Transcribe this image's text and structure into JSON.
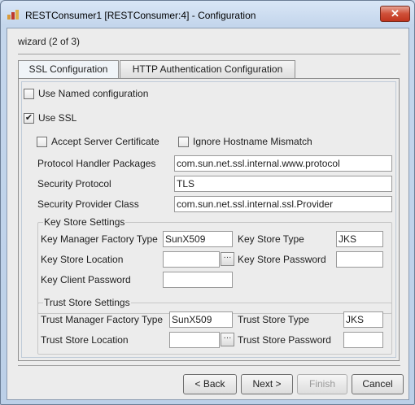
{
  "window": {
    "title": "RESTConsumer1 [RESTConsumer:4] - Configuration",
    "close_label": "✕"
  },
  "wizard": {
    "step": "wizard (2 of 3)"
  },
  "tabs": [
    {
      "label": "SSL Configuration",
      "active": true
    },
    {
      "label": "HTTP Authentication Configuration",
      "active": false
    }
  ],
  "ssl": {
    "use_named_configuration": {
      "label": "Use Named configuration",
      "checked": false
    },
    "use_ssl": {
      "label": "Use SSL",
      "checked": true
    },
    "accept_server_certificate": {
      "label": "Accept Server Certificate",
      "checked": false
    },
    "ignore_hostname_mismatch": {
      "label": "Ignore Hostname Mismatch",
      "checked": false
    },
    "protocol_handler_packages": {
      "label": "Protocol Handler Packages",
      "value": "com.sun.net.ssl.internal.www.protocol"
    },
    "security_protocol": {
      "label": "Security Protocol",
      "value": "TLS"
    },
    "security_provider_class": {
      "label": "Security Provider Class",
      "value": "com.sun.net.ssl.internal.ssl.Provider"
    }
  },
  "key_store": {
    "title": "Key Store Settings",
    "manager_factory_type": {
      "label": "Key Manager Factory Type",
      "value": "SunX509"
    },
    "store_type": {
      "label": "Key Store Type",
      "value": "JKS"
    },
    "store_location": {
      "label": "Key Store Location",
      "value": ""
    },
    "store_password": {
      "label": "Key Store Password",
      "value": ""
    },
    "client_password": {
      "label": "Key Client Password",
      "value": ""
    },
    "browse_label": "···"
  },
  "trust_store": {
    "title": "Trust Store Settings",
    "manager_factory_type": {
      "label": "Trust Manager Factory Type",
      "value": "SunX509"
    },
    "store_type": {
      "label": "Trust Store Type",
      "value": "JKS"
    },
    "store_location": {
      "label": "Trust Store Location",
      "value": ""
    },
    "store_password": {
      "label": "Trust Store Password",
      "value": ""
    },
    "browse_label": "···"
  },
  "buttons": {
    "back": "< Back",
    "next": "Next >",
    "finish": "Finish",
    "cancel": "Cancel"
  }
}
